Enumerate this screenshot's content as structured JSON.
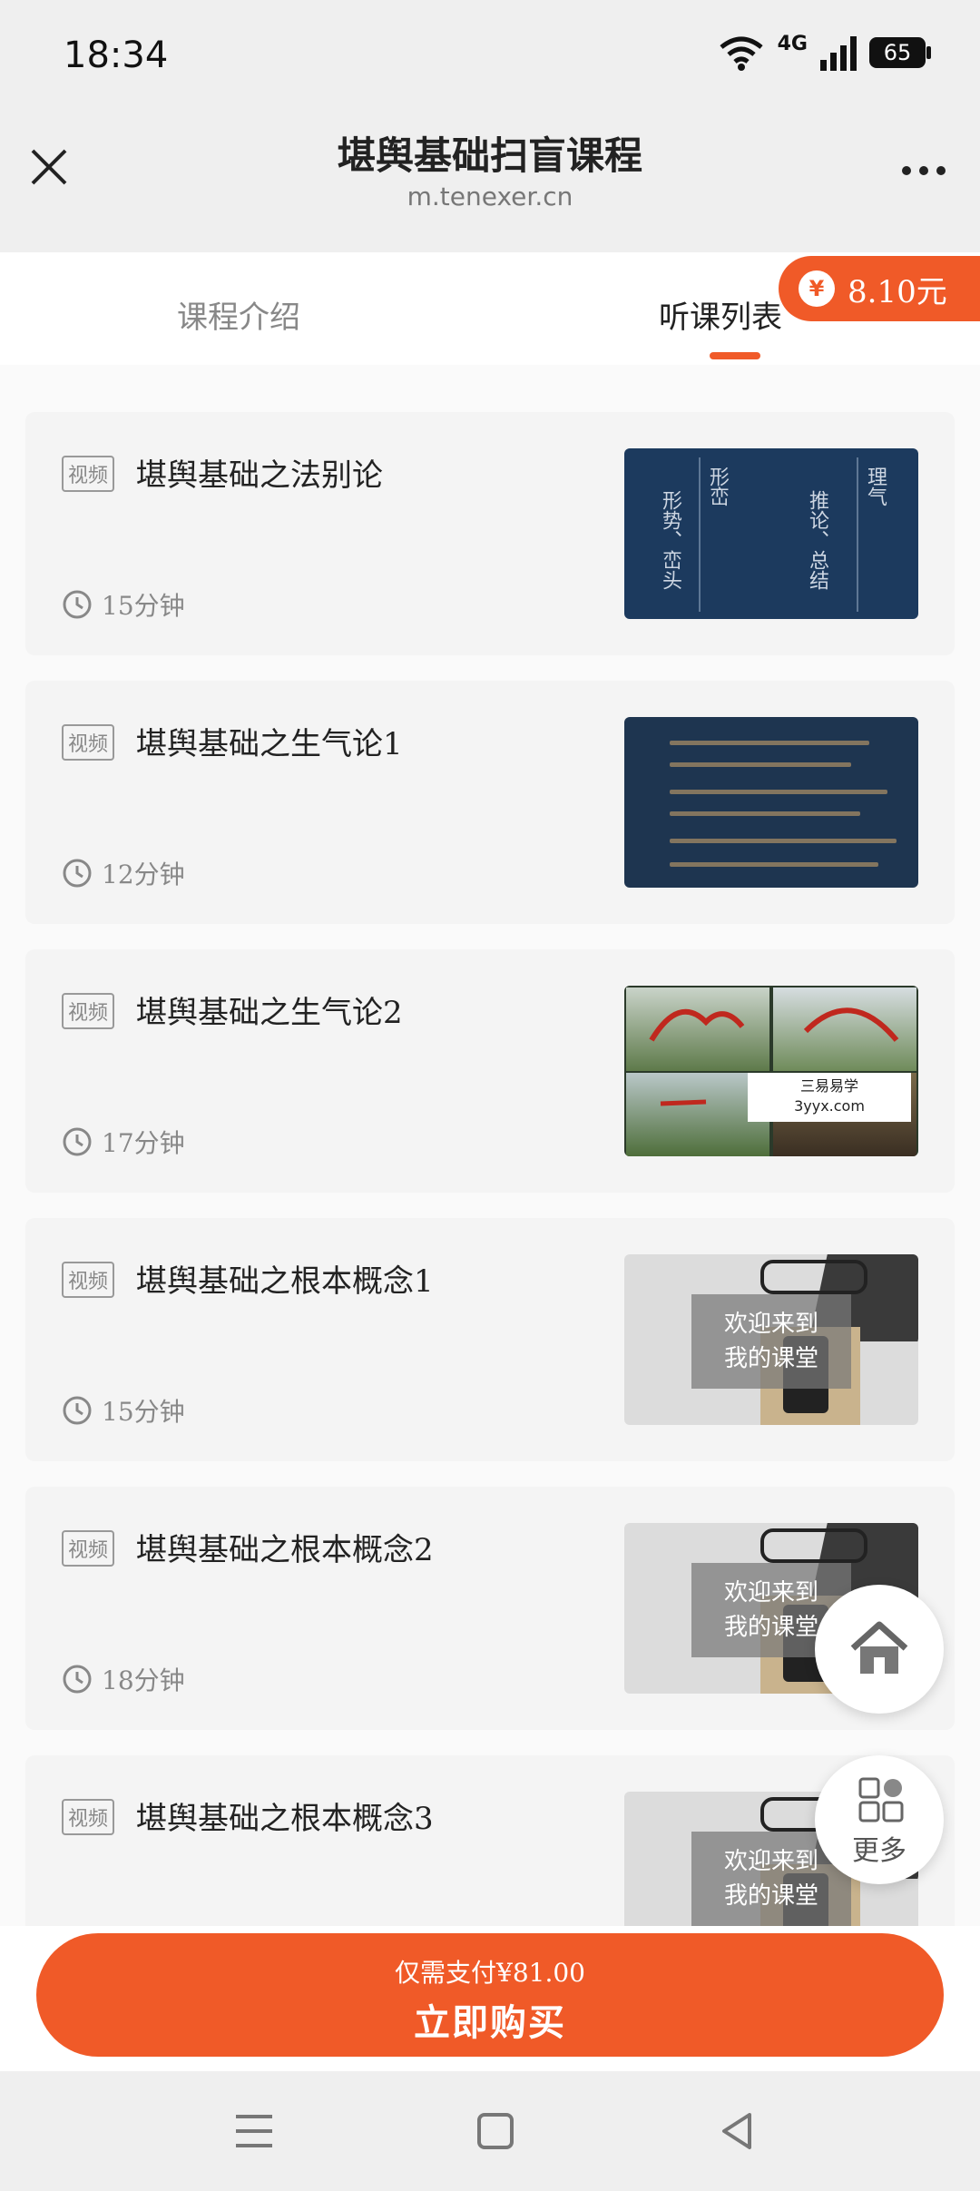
{
  "status_bar": {
    "time": "18:34",
    "network": "4G",
    "battery": "65"
  },
  "header": {
    "title": "堪舆基础扫盲课程",
    "domain": "m.tenexer.cn"
  },
  "tabs": [
    {
      "label": "课程介绍",
      "active": false
    },
    {
      "label": "听课列表",
      "active": true
    }
  ],
  "reward_badge": {
    "symbol": "¥",
    "amount": "8.10元"
  },
  "courses": [
    {
      "tag": "视频",
      "title": "堪舆基础之法别论",
      "duration": "15分钟"
    },
    {
      "tag": "视频",
      "title": "堪舆基础之生气论1",
      "duration": "12分钟"
    },
    {
      "tag": "视频",
      "title": "堪舆基础之生气论2",
      "duration": "17分钟"
    },
    {
      "tag": "视频",
      "title": "堪舆基础之根本概念1",
      "duration": "15分钟"
    },
    {
      "tag": "视频",
      "title": "堪舆基础之根本概念2",
      "duration": "18分钟"
    },
    {
      "tag": "视频",
      "title": "堪舆基础之根本概念3",
      "duration": ""
    }
  ],
  "thumbnails": {
    "lesson1": {
      "col1": "形势、峦头",
      "col2": "形峦",
      "col3": "推论、总结",
      "col4": "理气"
    },
    "welcome": {
      "line1": "欢迎来到",
      "line2": "我的课堂"
    }
  },
  "watermark": {
    "line1": "三易易学",
    "line2": "3yyx.com"
  },
  "floating": {
    "more_label": "更多"
  },
  "purchase": {
    "price_text": "仅需支付¥81.00",
    "button_label": "立即购买"
  },
  "colors": {
    "accent": "#f05a28",
    "card_bg": "#f4f4f4"
  }
}
